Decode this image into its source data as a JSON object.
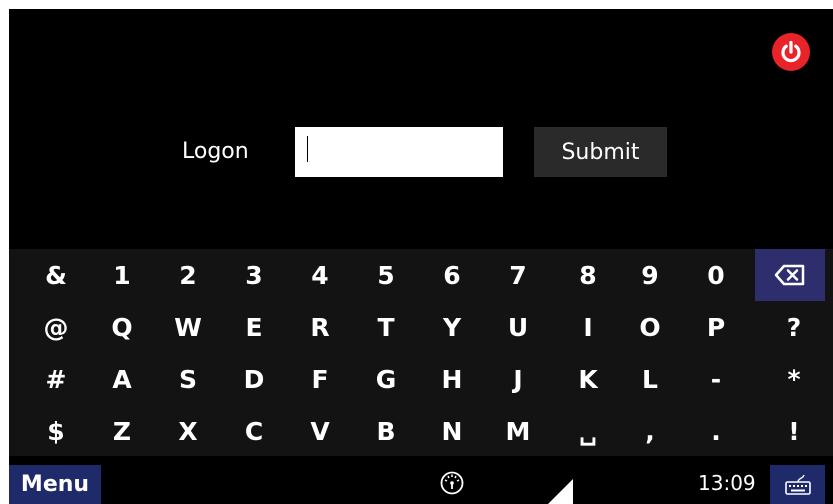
{
  "logon": {
    "label": "Logon",
    "value": "",
    "submit_label": "Submit"
  },
  "keyboard": {
    "rows": [
      [
        "&",
        "1",
        "2",
        "3",
        "4",
        "5",
        "6",
        "7",
        "8",
        "9",
        "0"
      ],
      [
        "@",
        "Q",
        "W",
        "E",
        "R",
        "T",
        "Y",
        "U",
        "I",
        "O",
        "P",
        "?"
      ],
      [
        "#",
        "A",
        "S",
        "D",
        "F",
        "G",
        "H",
        "J",
        "K",
        "L",
        "-",
        "*"
      ],
      [
        "$",
        "Z",
        "X",
        "C",
        "V",
        "B",
        "N",
        "M",
        "␣",
        ",",
        ".",
        "!"
      ]
    ],
    "backspace_icon": "backspace-icon"
  },
  "taskbar": {
    "menu_label": "Menu",
    "clock": "13:09",
    "icons": [
      "dashboard-icon",
      "signal-icon",
      "keyboard-icon"
    ]
  },
  "colors": {
    "power": "#e8232a",
    "accent": "#1f2a6a",
    "backspace_bg": "#2e2e6e"
  }
}
